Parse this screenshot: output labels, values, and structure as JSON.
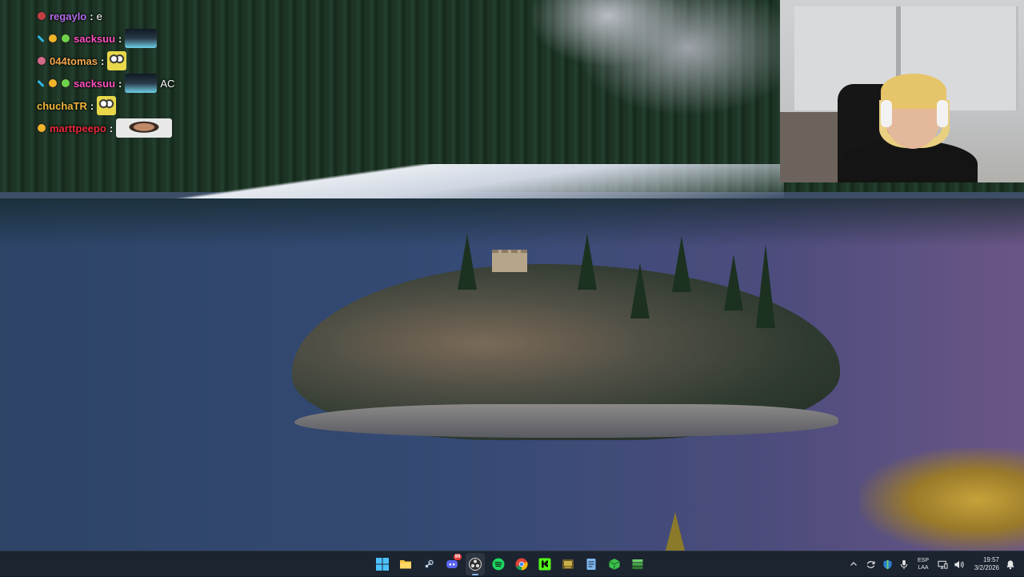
{
  "chat": {
    "lines": [
      {
        "name": "regaylo",
        "name_color": "#b46ae8",
        "message": "e",
        "badges": [
          "#c04040"
        ],
        "emote": null
      },
      {
        "name": "sacksuu",
        "name_color": "#ff4fbf",
        "message": "",
        "badges": [
          "#2fb6e0",
          "#f0b42a",
          "#6fd24a"
        ],
        "emote": "sacksuu-emote"
      },
      {
        "name": "044tomas",
        "name_color": "#f2a64b",
        "message": "",
        "badges": [
          "#d46a8a"
        ],
        "emote": "tomas-emote"
      },
      {
        "name": "sacksuu",
        "name_color": "#ff4fbf",
        "message": "AC",
        "badges": [
          "#2fb6e0",
          "#f0b42a",
          "#6fd24a"
        ],
        "emote": "sacksuu-emote"
      },
      {
        "name": "chuchaTR",
        "name_color": "#f2b63c",
        "message": "",
        "badges": [],
        "emote": "chucha-emote"
      },
      {
        "name": "marttpeepo",
        "name_color": "#e8283a",
        "message": "",
        "badges": [
          "#f0b42a"
        ],
        "emote": "marttpeepo-emote"
      }
    ]
  },
  "taskbar": {
    "apps": [
      {
        "name": "windows-start",
        "icon": "windows-icon",
        "color": "#4cc2ff",
        "active": false,
        "badge": ""
      },
      {
        "name": "file-explorer",
        "icon": "folder-icon",
        "color": "#f5c542",
        "active": false,
        "badge": ""
      },
      {
        "name": "steam",
        "icon": "steam-icon",
        "color": "#c7d5e0",
        "active": false,
        "badge": ""
      },
      {
        "name": "discord",
        "icon": "discord-icon",
        "color": "#5865f2",
        "active": false,
        "badge": "99"
      },
      {
        "name": "obs",
        "icon": "obs-icon",
        "color": "#e0e0e0",
        "active": true,
        "badge": ""
      },
      {
        "name": "spotify",
        "icon": "spotify-icon",
        "color": "#1ed760",
        "active": false,
        "badge": ""
      },
      {
        "name": "chrome",
        "icon": "chrome-icon",
        "color": "#db4437",
        "active": false,
        "badge": ""
      },
      {
        "name": "kick",
        "icon": "kick-icon",
        "color": "#53fc18",
        "active": false,
        "badge": ""
      },
      {
        "name": "game-launcher",
        "icon": "game-icon",
        "color": "#c9b04a",
        "active": false,
        "badge": ""
      },
      {
        "name": "notepad",
        "icon": "notepad-icon",
        "color": "#7fb8f0",
        "active": false,
        "badge": ""
      },
      {
        "name": "app-green",
        "icon": "package-icon",
        "color": "#3bbf4a",
        "active": false,
        "badge": ""
      },
      {
        "name": "app-stack",
        "icon": "stack-icon",
        "color": "#6fcf6a",
        "active": false,
        "badge": ""
      }
    ],
    "tray": {
      "language_line1": "ESP",
      "language_line2": "LAA",
      "time": "19:57",
      "date": "3/2/2026"
    }
  }
}
